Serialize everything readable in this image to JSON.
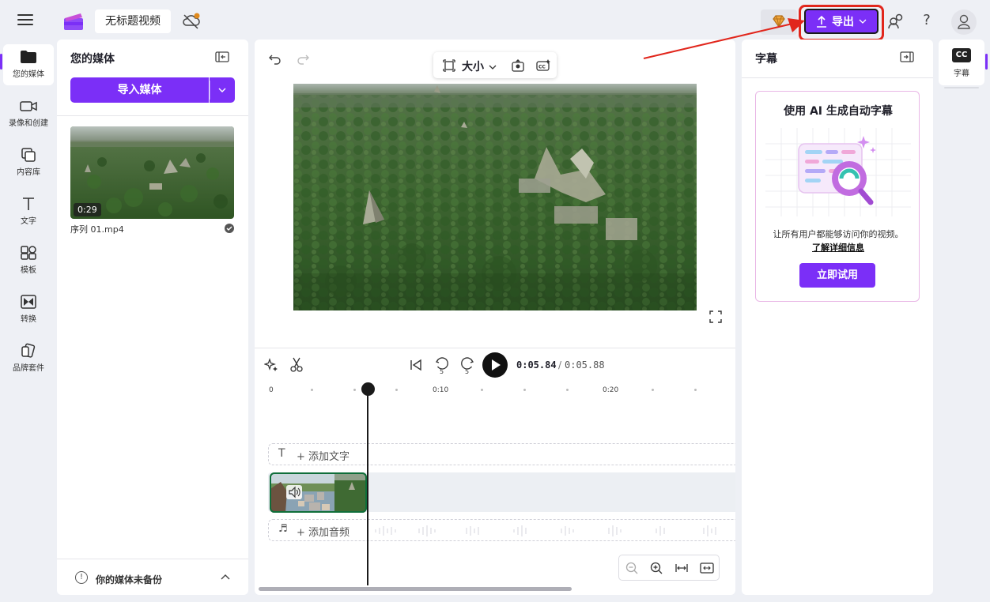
{
  "header": {
    "project_title": "无标题视频",
    "export_label": "导出"
  },
  "leftnav": {
    "items": [
      {
        "label": "您的媒体",
        "icon": "folder-icon"
      },
      {
        "label": "录像和创建",
        "icon": "camera-icon"
      },
      {
        "label": "内容库",
        "icon": "library-icon"
      },
      {
        "label": "文字",
        "icon": "text-icon"
      },
      {
        "label": "模板",
        "icon": "templates-icon"
      },
      {
        "label": "转换",
        "icon": "transitions-icon"
      },
      {
        "label": "品牌套件",
        "icon": "brand-kit-icon"
      }
    ]
  },
  "media": {
    "title": "您的媒体",
    "import_label": "导入媒体",
    "items": [
      {
        "duration": "0:29",
        "filename": "序列 01.mp4"
      }
    ],
    "backup_text": "你的媒体未备份"
  },
  "editor": {
    "size_label": "大小",
    "time_current": "0:05.84",
    "time_separator": "/",
    "time_total": "0:05.88",
    "ruler_labels": [
      "0",
      "0:10",
      "0:20"
    ],
    "skip_back_seconds": "5",
    "skip_forward_seconds": "5",
    "add_text_label": "+ 添加文字",
    "add_audio_label": "+ 添加音频"
  },
  "captions": {
    "title": "字幕",
    "card_title": "使用 AI 生成自动字幕",
    "card_desc": "让所有用户都能够访问你的视频。",
    "learn_more": "了解详细信息",
    "try_label": "立即试用"
  },
  "righttab": {
    "badge": "CC",
    "label": "字幕"
  },
  "colors": {
    "accent": "#7b2ff7",
    "annotation": "#e1261c"
  }
}
